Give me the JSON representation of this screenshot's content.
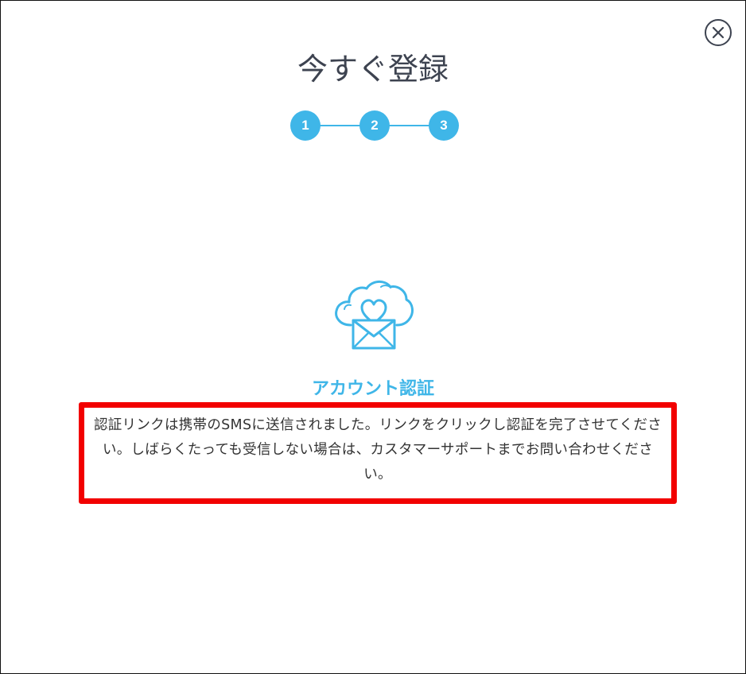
{
  "dialog": {
    "title": "今すぐ登録",
    "close_icon": "close-icon"
  },
  "stepper": {
    "steps": [
      "1",
      "2",
      "3"
    ],
    "current": 3,
    "color": "#3fb6e8"
  },
  "verification": {
    "icon": "cloud-heart-envelope-icon",
    "heading": "アカウント認証",
    "message": "認証リンクは携帯のSMSに送信されました。リンクをクリックし認証を完了させてください。しばらくたっても受信しない場合は、カスタマーサポートまでお問い合わせください。"
  },
  "colors": {
    "accent": "#3fb6e8",
    "highlight": "#f20000",
    "text": "#333333"
  }
}
